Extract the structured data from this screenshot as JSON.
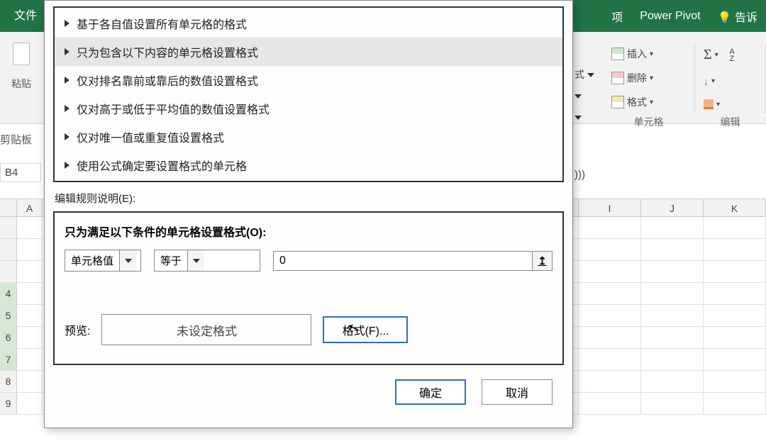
{
  "ribbon": {
    "file_tab": "文件",
    "right_tabs": [
      "项",
      "Power Pivot",
      "告诉"
    ],
    "tell_me_icon": "lightbulb-icon",
    "cells_group": {
      "label": "单元格",
      "insert": "插入",
      "delete": "删除",
      "format": "格式"
    },
    "editing_group": {
      "label": "编辑",
      "sum": "Σ",
      "sort": "A↓Z"
    },
    "style_label": "式",
    "paste_label": "粘贴",
    "clipboard_label": "剪贴板"
  },
  "name_box": "B4",
  "formula_remnant": ")))",
  "columns": {
    "first": "A",
    "right": [
      "I",
      "J",
      "K"
    ]
  },
  "row_numbers": [
    "",
    "",
    "4",
    "5",
    "6",
    "7",
    "8",
    "9"
  ],
  "dialog": {
    "rule_types": [
      "基于各自值设置所有单元格的格式",
      "只为包含以下内容的单元格设置格式",
      "仅对排名靠前或靠后的数值设置格式",
      "仅对高于或低于平均值的数值设置格式",
      "仅对唯一值或重复值设置格式",
      "使用公式确定要设置格式的单元格"
    ],
    "selected_rule_index": 1,
    "edit_rule_label": "编辑规则说明(E):",
    "criteria_header": "只为满足以下条件的单元格设置格式(O):",
    "combo1": "单元格值",
    "combo2": "等于",
    "value_input": "0",
    "preview_label": "预览:",
    "preview_text": "未设定格式",
    "format_button": "格式(F)...",
    "ok_button": "确定",
    "cancel_button": "取消"
  }
}
